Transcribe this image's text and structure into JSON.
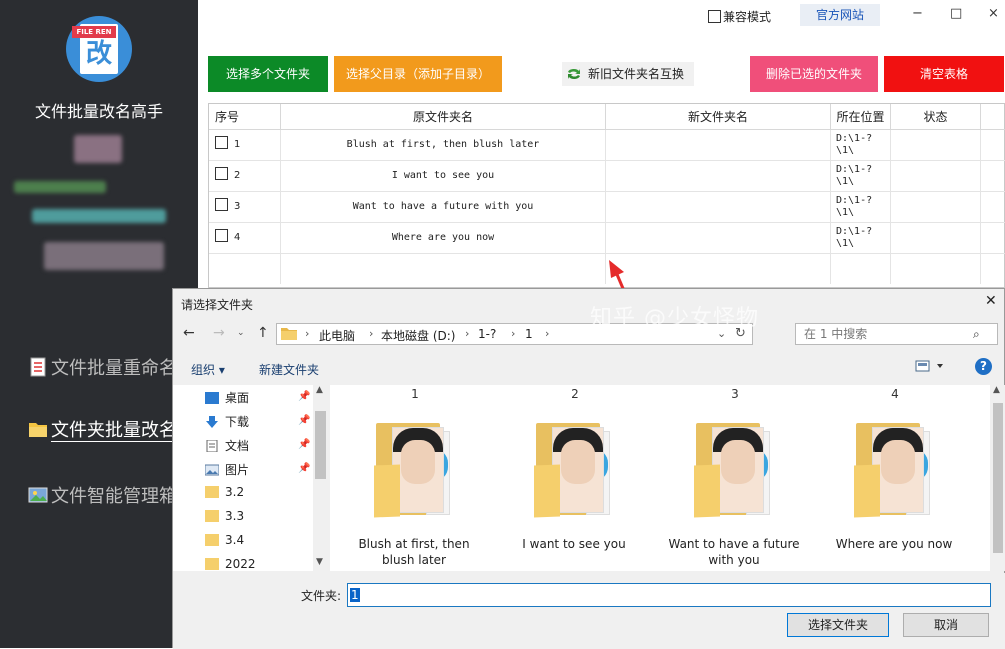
{
  "app": {
    "title": "文件批量改名高手",
    "logo_band": "FILE REN",
    "logo_char": "改"
  },
  "nav": [
    {
      "label": "文件批量重命名"
    },
    {
      "label": "文件夹批量改名"
    },
    {
      "label": "文件智能管理箱"
    }
  ],
  "topbar": {
    "compat_label": "兼容模式",
    "official_label": "官方网站",
    "minimize": "−",
    "maximize": "□",
    "close": "×"
  },
  "toolbar": {
    "select_multi": "选择多个文件夹",
    "select_parent": "选择父目录（添加子目录）",
    "swap": "新旧文件夹名互换",
    "delete_selected": "删除已选的文件夹",
    "clear_table": "清空表格",
    "colors": {
      "green": "#0c8a27",
      "orange": "#f29a1c",
      "pink": "#f04f7a",
      "red": "#f11111"
    }
  },
  "table": {
    "headers": [
      "序号",
      "原文件夹名",
      "新文件夹名",
      "所在位置",
      "状态"
    ],
    "rows": [
      {
        "index": "1",
        "original": "Blush at first, then blush later",
        "new": "",
        "location": "D:\\1-?\n\\1\\",
        "status": ""
      },
      {
        "index": "2",
        "original": "I want to see you",
        "new": "",
        "location": "D:\\1-?\n\\1\\",
        "status": ""
      },
      {
        "index": "3",
        "original": "Want to have a future with you",
        "new": "",
        "location": "D:\\1-?\n\\1\\",
        "status": ""
      },
      {
        "index": "4",
        "original": "Where are you now",
        "new": "",
        "location": "D:\\1-?\n\\1\\",
        "status": ""
      }
    ]
  },
  "dialog": {
    "title": "请选择文件夹",
    "close": "✕",
    "breadcrumb": [
      "此电脑",
      "本地磁盘 (D:)",
      "1-?",
      "1"
    ],
    "search_placeholder": "在 1 中搜索",
    "organize": "组织 ▾",
    "new_folder": "新建文件夹",
    "help": "?",
    "tree": [
      {
        "label": "桌面",
        "icon": "desktop-icon",
        "pinned": true
      },
      {
        "label": "下载",
        "icon": "download-icon",
        "pinned": true
      },
      {
        "label": "文档",
        "icon": "document-icon",
        "pinned": true
      },
      {
        "label": "图片",
        "icon": "pictures-icon",
        "pinned": true
      },
      {
        "label": "3.2",
        "icon": "folder-icon",
        "pinned": false
      },
      {
        "label": "3.3",
        "icon": "folder-icon",
        "pinned": false
      },
      {
        "label": "3.4",
        "icon": "folder-icon",
        "pinned": false
      },
      {
        "label": "2022",
        "icon": "folder-icon",
        "pinned": false
      }
    ],
    "column_numbers": [
      "1",
      "2",
      "3",
      "4"
    ],
    "folders": [
      {
        "name": "Blush at first, then blush later"
      },
      {
        "name": "I want to see you"
      },
      {
        "name": "Want to have a future with you"
      },
      {
        "name": "Where are you now"
      }
    ],
    "folder_label": "文件夹:",
    "folder_value": "1",
    "select_button": "选择文件夹",
    "cancel_button": "取消"
  },
  "watermark": "知乎 @少女怪物"
}
